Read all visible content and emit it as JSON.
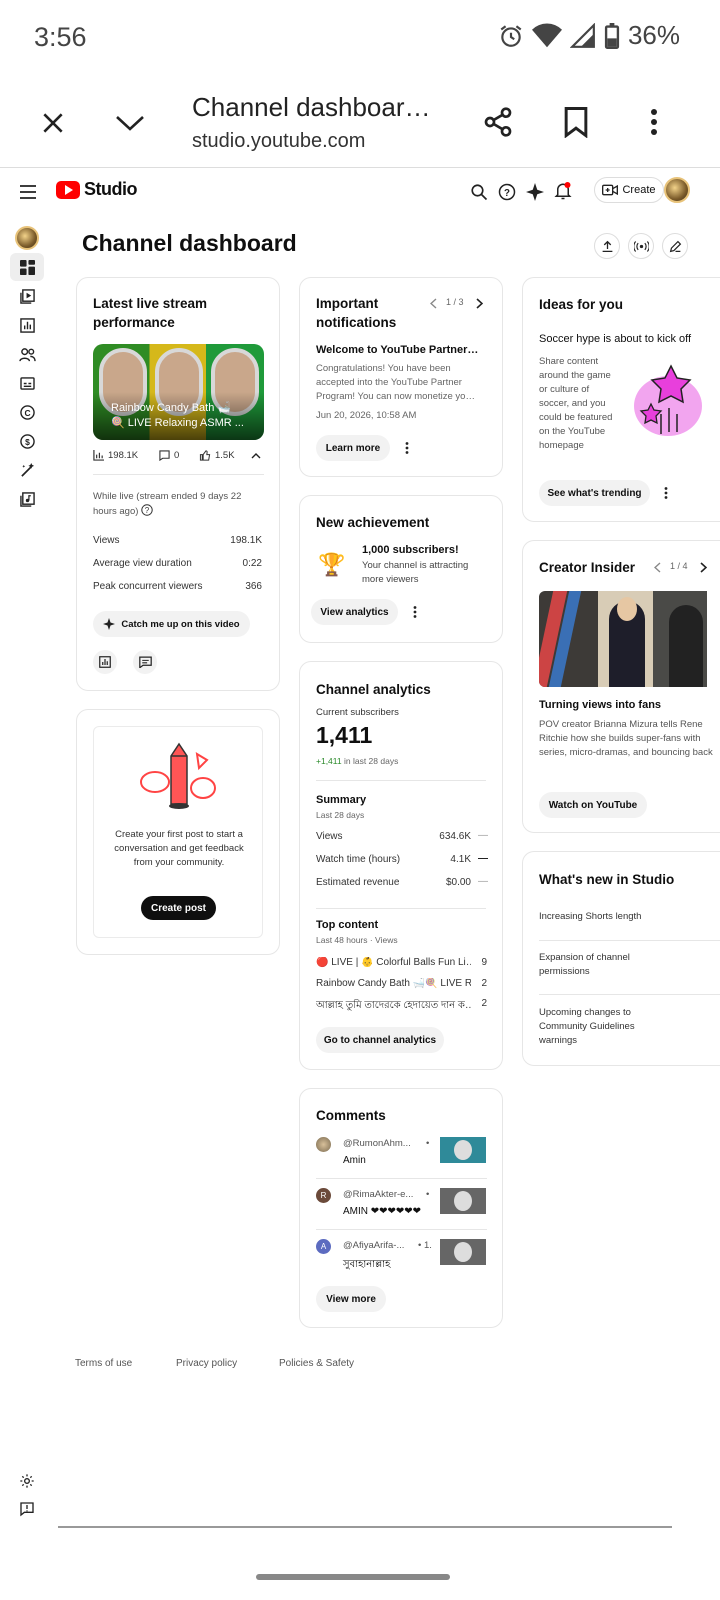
{
  "status": {
    "time": "3:56",
    "battery": "36%"
  },
  "browser": {
    "title": "Channel dashboar…",
    "url": "studio.youtube.com"
  },
  "studio": {
    "logo_text": "Studio",
    "create_label": "Create"
  },
  "page": {
    "title": "Channel dashboard"
  },
  "live": {
    "title": "Latest live stream performance",
    "thumb_line1": "Rainbow Candy Bath 🛁",
    "thumb_line2": "🍭 LIVE Relaxing ASMR ...",
    "views_stat": "198.1K",
    "comments_stat": "0",
    "likes_stat": "1.5K",
    "note": "While live (stream ended 9 days 22 hours ago)",
    "rows": [
      {
        "label": "Views",
        "value": "198.1K"
      },
      {
        "label": "Average view duration",
        "value": "0:22"
      },
      {
        "label": "Peak concurrent viewers",
        "value": "366"
      }
    ],
    "catch_up": "Catch me up on this video"
  },
  "post": {
    "text": "Create your first post to start a conversation and get feedback from your community.",
    "button": "Create post"
  },
  "notif": {
    "title": "Important notifications",
    "pager": "1 / 3",
    "headline": "Welcome to YouTube Partner…",
    "body": "Congratulations! You have been accepted into the YouTube Partner Program! You can now monetize yo…",
    "date": "Jun 20, 2026, 10:58 AM",
    "button": "Learn more"
  },
  "achievement": {
    "title": "New achievement",
    "headline": "1,000 subscribers!",
    "body": "Your channel is attracting more viewers",
    "button": "View analytics"
  },
  "analytics": {
    "title": "Channel analytics",
    "subs_label": "Current subscribers",
    "subs": "1,411",
    "subs_change": "+1,411",
    "subs_change_period": "in last 28 days",
    "summary": "Summary",
    "summary_period": "Last 28 days",
    "rows": [
      {
        "label": "Views",
        "value": "634.6K",
        "trend": "—"
      },
      {
        "label": "Watch time (hours)",
        "value": "4.1K",
        "trend": "—"
      },
      {
        "label": "Estimated revenue",
        "value": "$0.00",
        "trend": "—"
      }
    ],
    "top_title": "Top content",
    "top_period": "Last 48 hours · Views",
    "top": [
      {
        "title": "🔴 LIVE | 👶 Colorful Balls Fun Li…",
        "value": "9"
      },
      {
        "title": "Rainbow Candy Bath 🛁🍭 LIVE R…",
        "value": "2"
      },
      {
        "title": "আল্লাহ তুমি তাদেরকে হেদায়েত দান ক…",
        "value": "2"
      }
    ],
    "button": "Go to channel analytics"
  },
  "comments": {
    "title": "Comments",
    "items": [
      {
        "author": "@RumonAhm...",
        "extra": "•",
        "text": "Amin",
        "initial": ""
      },
      {
        "author": "@RimaAkter-e...",
        "extra": "•",
        "text": "AMIN ❤❤❤❤❤❤",
        "initial": "R"
      },
      {
        "author": "@AfiyaArifa-...",
        "extra": "• 1.",
        "text": "সুবাহানাল্লাহ",
        "initial": "A"
      }
    ],
    "button": "View more"
  },
  "ideas": {
    "title": "Ideas for you",
    "headline": "Soccer hype is about to kick off",
    "body": "Share content around the game or culture of soccer, and you could be featured on the YouTube homepage",
    "button": "See what's trending"
  },
  "insider": {
    "title": "Creator Insider",
    "pager": "1 / 4",
    "headline": "Turning views into fans",
    "body": "POV creator Brianna Mizura tells Rene Ritchie how she builds super-fans with series, micro-dramas, and bouncing back",
    "button": "Watch on YouTube"
  },
  "whatsnew": {
    "title": "What's new in Studio",
    "items": [
      "Increasing Shorts length",
      "Expansion of channel permissions",
      "Upcoming changes to Community Guidelines warnings"
    ]
  },
  "footer": {
    "terms": "Terms of use",
    "privacy": "Privacy policy",
    "policies": "Policies & Safety"
  }
}
